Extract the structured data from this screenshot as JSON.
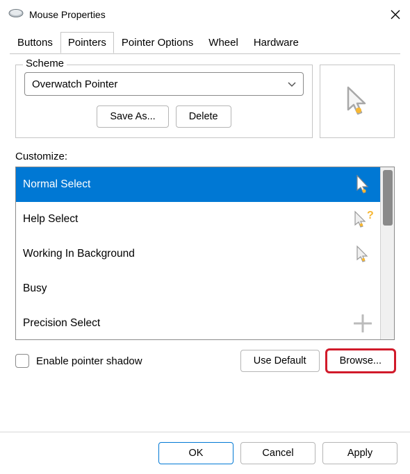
{
  "window": {
    "title": "Mouse Properties"
  },
  "tabs": {
    "items": [
      {
        "label": "Buttons"
      },
      {
        "label": "Pointers"
      },
      {
        "label": "Pointer Options"
      },
      {
        "label": "Wheel"
      },
      {
        "label": "Hardware"
      }
    ],
    "active_index": 1
  },
  "scheme": {
    "legend": "Scheme",
    "selected": "Overwatch Pointer",
    "save_as_label": "Save As...",
    "delete_label": "Delete"
  },
  "customize": {
    "label": "Customize:",
    "items": [
      {
        "label": "Normal Select",
        "icon": "pointer-arrow",
        "selected": true
      },
      {
        "label": "Help Select",
        "icon": "pointer-help",
        "selected": false
      },
      {
        "label": "Working In Background",
        "icon": "pointer-busy-bg",
        "selected": false
      },
      {
        "label": "Busy",
        "icon": "pointer-busy",
        "selected": false
      },
      {
        "label": "Precision Select",
        "icon": "pointer-precision",
        "selected": false
      }
    ],
    "shadow_label": "Enable pointer shadow",
    "use_default_label": "Use Default",
    "browse_label": "Browse..."
  },
  "footer": {
    "ok_label": "OK",
    "cancel_label": "Cancel",
    "apply_label": "Apply"
  }
}
